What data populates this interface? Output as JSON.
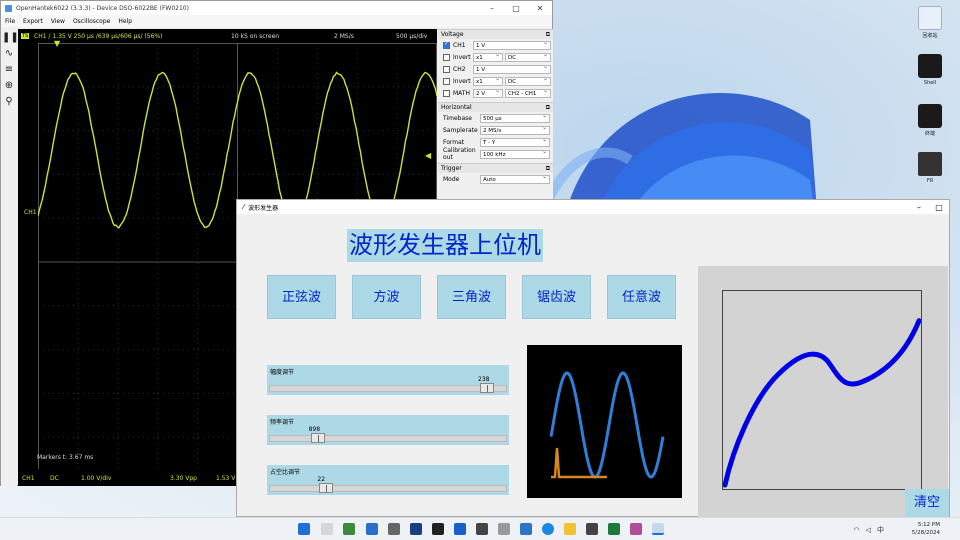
{
  "osc": {
    "title": "OpenHantek6022 (3.3.3) - Device DSO-6022BE (FW0210)",
    "menu": [
      "File",
      "Export",
      "View",
      "Oscilloscope",
      "Help"
    ],
    "ts_badge": "TS",
    "top_info": "CH1  /  1.35 V  250 µs  /639 µs/606 µs/ (56%)",
    "samples": "10 kS on screen",
    "rate": "2 MS/s",
    "timediv": "500 µs/div",
    "ch_label": "CH1",
    "markers": "Markers   t: 3.67 ms",
    "bottom": [
      "CH1",
      "DC",
      "1.00 V/div",
      "3.30 Vpp",
      "1.53 V~"
    ],
    "voltage": {
      "title": "Voltage",
      "rows": [
        {
          "label": "CH1",
          "value": "1 V",
          "checked": true
        },
        {
          "label": "Invert",
          "x": "x1",
          "coupling": "DC"
        },
        {
          "label": "CH2",
          "value": "1 V",
          "checked": false
        },
        {
          "label": "Invert",
          "x": "x1",
          "coupling": "DC"
        },
        {
          "label": "MATH",
          "value": "2 V",
          "math": "CH2 - CH1"
        }
      ]
    },
    "horizontal": {
      "title": "Horizontal",
      "rows": [
        {
          "label": "Timebase",
          "value": "500 µs"
        },
        {
          "label": "Samplerate",
          "value": "2 MS/s"
        },
        {
          "label": "Format",
          "value": "T - Y"
        },
        {
          "label": "Calibration out",
          "value": "100 kHz"
        }
      ]
    },
    "trigger": {
      "title": "Trigger",
      "mode_label": "Mode",
      "mode_value": "Auto"
    }
  },
  "gen": {
    "title": "波形发生器",
    "app_title": "波形发生器上位机",
    "buttons": [
      "正弦波",
      "方波",
      "三角波",
      "锯齿波",
      "任意波"
    ],
    "sliders": [
      {
        "label": "幅度调节",
        "value": "238",
        "level": 0.95
      },
      {
        "label": "频率调节",
        "value": "898",
        "level": 0.18
      },
      {
        "label": "占空比调节",
        "value": "22",
        "level": 0.22
      }
    ],
    "clear": "清空"
  },
  "desktop": {
    "icons": [
      "回收站",
      "Shell",
      "终端",
      "FR"
    ]
  },
  "taskbar": {
    "time": "5:12 PM",
    "date": "5/28/2024",
    "tray": "中"
  }
}
